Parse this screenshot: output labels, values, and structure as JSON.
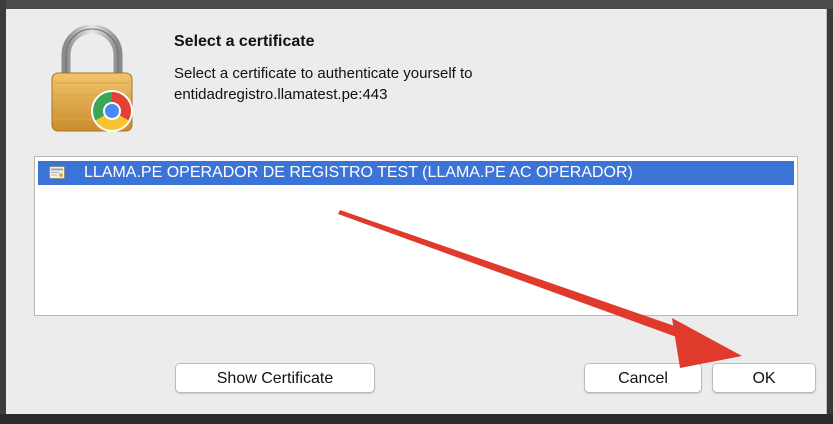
{
  "dialog": {
    "title": "Select a certificate",
    "message_line1": "Select a certificate to authenticate yourself to",
    "message_line2": "entidadregistro.llamatest.pe:443"
  },
  "certificates": [
    {
      "label": "LLAMA.PE OPERADOR DE REGISTRO TEST  (LLAMA.PE AC OPERADOR)",
      "selected": true,
      "icon": "certificate-icon"
    }
  ],
  "buttons": {
    "show_certificate": "Show Certificate",
    "cancel": "Cancel",
    "ok": "OK"
  },
  "icons": {
    "lock": "padlock-chrome-icon"
  },
  "colors": {
    "selection": "#3b74d6",
    "annotation_arrow": "#e03a2c",
    "dialog_bg": "#ececec"
  }
}
